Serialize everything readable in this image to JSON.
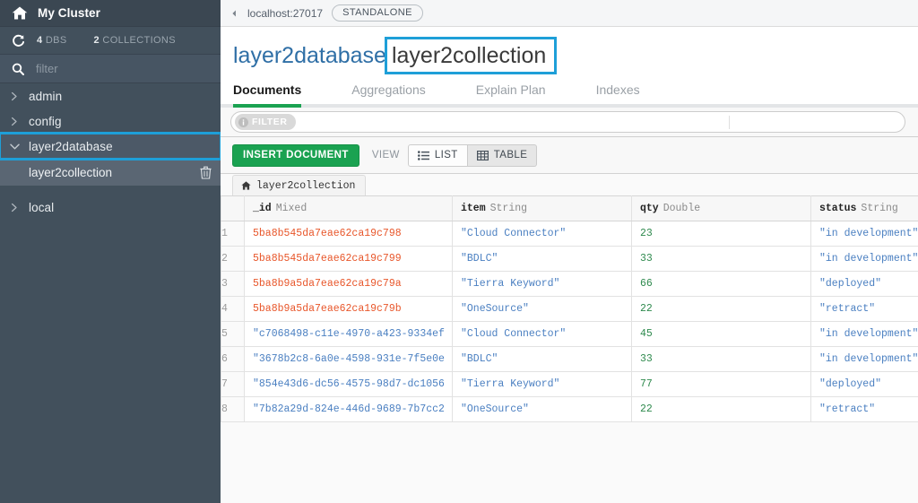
{
  "sidebar": {
    "cluster_name": "My Cluster",
    "home_icon": "home-icon",
    "refresh_icon": "refresh-icon",
    "db_count": "4",
    "db_count_label": "DBS",
    "collection_count": "2",
    "collection_count_label": "COLLECTIONS",
    "search_icon": "search-icon",
    "filter_placeholder": "filter",
    "filter_value": "",
    "databases": [
      {
        "name": "admin",
        "expanded": false,
        "highlighted": false
      },
      {
        "name": "config",
        "expanded": false,
        "highlighted": false
      },
      {
        "name": "layer2database",
        "expanded": true,
        "highlighted": true
      },
      {
        "name": "local",
        "expanded": false,
        "highlighted": false
      }
    ],
    "collection_item": {
      "name": "layer2collection",
      "delete_icon": "trash-icon"
    }
  },
  "connection_bar": {
    "collapse_icon": "chevron-left-icon",
    "host": "localhost:27017",
    "topology_badge": "STANDALONE"
  },
  "namespace": {
    "database": "layer2database",
    "separator": ".",
    "collection": "layer2collection",
    "highlight_color": "#1e9fd8"
  },
  "tabs": [
    {
      "label": "Documents",
      "active": true
    },
    {
      "label": "Aggregations",
      "active": false
    },
    {
      "label": "Explain Plan",
      "active": false
    },
    {
      "label": "Indexes",
      "active": false
    }
  ],
  "filter_bar": {
    "badge_label": "FILTER",
    "info_icon": "info-icon",
    "query_value": "",
    "query_placeholder": ""
  },
  "toolbar": {
    "insert_label": "INSERT DOCUMENT",
    "view_label": "VIEW",
    "list_label": "LIST",
    "list_icon": "list-icon",
    "list_active": false,
    "table_label": "TABLE",
    "table_icon": "table-icon",
    "table_active": true
  },
  "collection_tab": {
    "home_icon": "home-icon",
    "label": "layer2collection"
  },
  "table": {
    "columns": [
      {
        "name": "_id",
        "type": "Mixed"
      },
      {
        "name": "item",
        "type": "String"
      },
      {
        "name": "qty",
        "type": "Double"
      },
      {
        "name": "status",
        "type": "String"
      }
    ],
    "rows": [
      {
        "n": "1",
        "id": "5ba8b545da7eae62ca19c798",
        "id_kind": "objectid",
        "item": "\"Cloud Connector\"",
        "qty": "23",
        "status": "\"in development\""
      },
      {
        "n": "2",
        "id": "5ba8b545da7eae62ca19c799",
        "id_kind": "objectid",
        "item": "\"BDLC\"",
        "qty": "33",
        "status": "\"in development\""
      },
      {
        "n": "3",
        "id": "5ba8b9a5da7eae62ca19c79a",
        "id_kind": "objectid",
        "item": "\"Tierra Keyword\"",
        "qty": "66",
        "status": "\"deployed\""
      },
      {
        "n": "4",
        "id": "5ba8b9a5da7eae62ca19c79b",
        "id_kind": "objectid",
        "item": "\"OneSource\"",
        "qty": "22",
        "status": "\"retract\""
      },
      {
        "n": "5",
        "id": "\"c7068498-c11e-4970-a423-9334ef",
        "id_kind": "string",
        "item": "\"Cloud Connector\"",
        "qty": "45",
        "status": "\"in development\""
      },
      {
        "n": "6",
        "id": "\"3678b2c8-6a0e-4598-931e-7f5e0e",
        "id_kind": "string",
        "item": "\"BDLC\"",
        "qty": "33",
        "status": "\"in development\""
      },
      {
        "n": "7",
        "id": "\"854e43d6-dc56-4575-98d7-dc1056",
        "id_kind": "string",
        "item": "\"Tierra Keyword\"",
        "qty": "77",
        "status": "\"deployed\""
      },
      {
        "n": "8",
        "id": "\"7b82a29d-824e-446d-9689-7b7cc2",
        "id_kind": "string",
        "item": "\"OneSource\"",
        "qty": "22",
        "status": "\"retract\""
      }
    ]
  }
}
